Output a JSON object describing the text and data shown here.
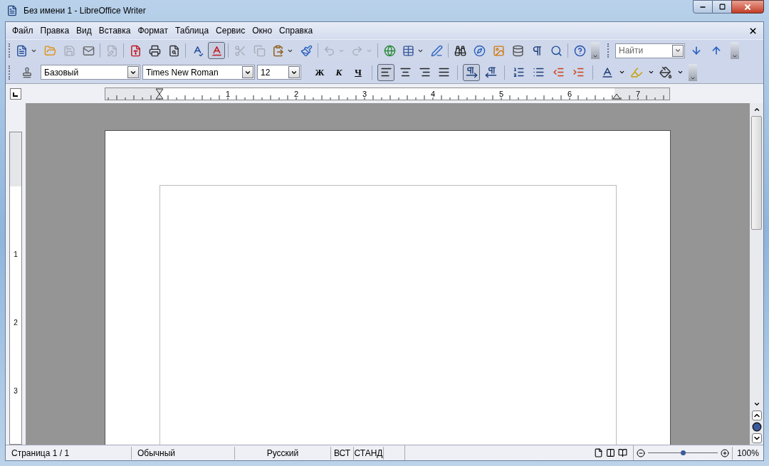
{
  "window": {
    "title": "Без имени 1 - LibreOffice Writer"
  },
  "menu": [
    {
      "label": "Файл"
    },
    {
      "label": "Правка"
    },
    {
      "label": "Вид"
    },
    {
      "label": "Вставка"
    },
    {
      "label": "Формат"
    },
    {
      "label": "Таблица"
    },
    {
      "label": "Сервис"
    },
    {
      "label": "Окно"
    },
    {
      "label": "Справка"
    }
  ],
  "standard_toolbar": {
    "groups": [
      [
        {
          "kind": "new",
          "dropdown": true,
          "disabled": false,
          "pressed": false
        },
        {
          "kind": "open",
          "dropdown": false,
          "disabled": false,
          "pressed": false
        },
        {
          "kind": "save",
          "dropdown": false,
          "disabled": true,
          "pressed": false
        },
        {
          "kind": "email",
          "dropdown": false,
          "disabled": false,
          "pressed": false
        }
      ],
      [
        {
          "kind": "edit",
          "dropdown": false,
          "disabled": true,
          "pressed": false
        }
      ],
      [
        {
          "kind": "pdf",
          "dropdown": false,
          "disabled": false,
          "pressed": false
        },
        {
          "kind": "print",
          "dropdown": false,
          "disabled": false,
          "pressed": false
        },
        {
          "kind": "preview",
          "dropdown": false,
          "disabled": false,
          "pressed": false
        }
      ],
      [
        {
          "kind": "spell",
          "dropdown": false,
          "disabled": false,
          "pressed": false
        },
        {
          "kind": "autospell",
          "dropdown": false,
          "disabled": false,
          "pressed": true
        }
      ],
      [
        {
          "kind": "cut",
          "dropdown": false,
          "disabled": true,
          "pressed": false
        },
        {
          "kind": "copy",
          "dropdown": false,
          "disabled": true,
          "pressed": false
        },
        {
          "kind": "paste",
          "dropdown": true,
          "disabled": false,
          "pressed": false
        },
        {
          "kind": "brush",
          "dropdown": false,
          "disabled": false,
          "pressed": false
        }
      ],
      [
        {
          "kind": "undo",
          "dropdown": true,
          "disabled": true,
          "pressed": false
        },
        {
          "kind": "redo",
          "dropdown": true,
          "disabled": true,
          "pressed": false
        }
      ],
      [
        {
          "kind": "globe",
          "dropdown": false,
          "disabled": false,
          "pressed": false
        },
        {
          "kind": "table",
          "dropdown": true,
          "disabled": false,
          "pressed": false
        },
        {
          "kind": "draw",
          "dropdown": false,
          "disabled": false,
          "pressed": false
        }
      ],
      [
        {
          "kind": "find",
          "dropdown": false,
          "disabled": false,
          "pressed": false
        },
        {
          "kind": "navigator",
          "dropdown": false,
          "disabled": false,
          "pressed": false
        },
        {
          "kind": "gallery",
          "dropdown": false,
          "disabled": false,
          "pressed": false
        },
        {
          "kind": "database",
          "dropdown": false,
          "disabled": false,
          "pressed": false
        },
        {
          "kind": "pilcrow",
          "dropdown": false,
          "disabled": false,
          "pressed": false
        },
        {
          "kind": "zoom",
          "dropdown": false,
          "disabled": false,
          "pressed": false
        }
      ],
      [
        {
          "kind": "help",
          "dropdown": false,
          "disabled": false,
          "pressed": false
        }
      ]
    ]
  },
  "find_toolbar": {
    "placeholder": "Найти"
  },
  "formatting_toolbar": {
    "style": "Базовый",
    "font": "Times New Roman",
    "size": "12",
    "text_buttons": [
      {
        "label": "Ж",
        "kind": "bold",
        "pressed": false
      },
      {
        "label": "К",
        "kind": "italic",
        "pressed": false
      },
      {
        "label": "Ч",
        "kind": "underline",
        "pressed": false
      }
    ],
    "align": [
      {
        "kind": "left",
        "selected": true
      },
      {
        "kind": "center",
        "selected": false
      },
      {
        "kind": "right",
        "selected": false
      },
      {
        "kind": "justify",
        "selected": false
      }
    ],
    "direction": [
      {
        "kind": "ltr",
        "selected": true
      },
      {
        "kind": "rtl",
        "selected": false
      }
    ]
  },
  "ruler": {
    "horizontal": [
      "1",
      "2",
      "3",
      "4",
      "5",
      "6",
      "7"
    ],
    "vertical": [
      "1",
      "2",
      "3"
    ]
  },
  "status_bar": {
    "page": "Страница 1 / 1",
    "style": "Обычный",
    "language": "Русский",
    "insert_mode": "ВСТ",
    "selection_mode": "СТАНД",
    "zoom": {
      "level": 0.5
    },
    "zoom_percent": "100%"
  }
}
